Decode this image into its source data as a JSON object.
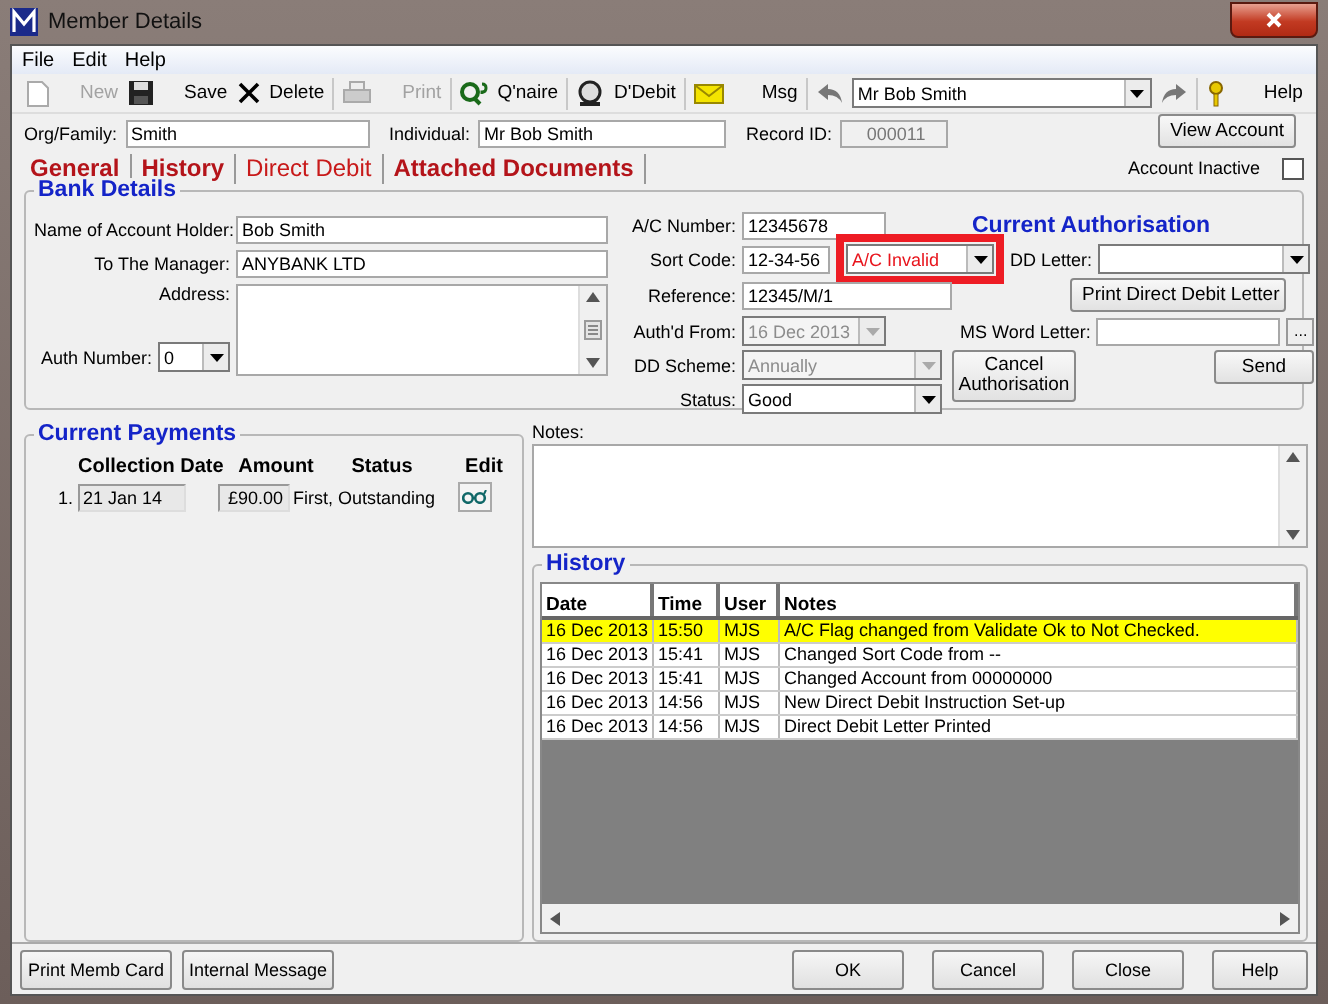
{
  "window": {
    "title": "Member Details"
  },
  "menu": [
    {
      "label": "File"
    },
    {
      "label": "Edit"
    },
    {
      "label": "Help"
    }
  ],
  "toolbar": [
    [
      {
        "kind": "button",
        "label": "New",
        "disabled": true
      },
      {
        "kind": "button",
        "label": "Save",
        "disabled": false
      },
      {
        "kind": "button",
        "label": "Delete",
        "disabled": false
      }
    ],
    [
      {
        "kind": "button",
        "label": "Print",
        "disabled": true
      }
    ],
    [
      {
        "kind": "button",
        "label": "Q'naire",
        "disabled": false
      }
    ],
    [
      {
        "kind": "button",
        "label": "D'Debit",
        "disabled": false
      }
    ],
    [
      {
        "kind": "button",
        "label": "Msg",
        "disabled": false
      }
    ],
    [
      {
        "kind": "icon_button"
      },
      {
        "kind": "combo",
        "value": "Mr Bob Smith"
      },
      {
        "kind": "icon_button"
      }
    ],
    [
      {
        "kind": "button",
        "label": "Help",
        "disabled": false
      }
    ]
  ],
  "header": {
    "org_family": {
      "label": "Org/Family:",
      "value": "Smith"
    },
    "individual": {
      "label": "Individual:",
      "value": "Mr Bob Smith"
    },
    "record_id": {
      "label": "Record ID:",
      "value": "000011"
    },
    "view_account": "View Account",
    "account_inactive": {
      "label": "Account Inactive",
      "checked": false
    }
  },
  "tabs": [
    {
      "label": "General",
      "selected": false
    },
    {
      "label": "History",
      "selected": false
    },
    {
      "label": "Direct Debit",
      "selected": true
    },
    {
      "label": "Attached Documents",
      "selected": false
    }
  ],
  "bank_details": {
    "title": "Bank Details",
    "account_holder": {
      "label": "Name of Account Holder:",
      "value": "Bob Smith"
    },
    "manager": {
      "label": "To The Manager:",
      "value": "ANYBANK LTD"
    },
    "address": {
      "label": "Address:"
    },
    "auth_number": {
      "label": "Auth Number:",
      "value": "0"
    },
    "ac_number": {
      "label": "A/C Number:",
      "value": "12345678"
    },
    "sort_code": {
      "label": "Sort Code:",
      "value": "12-34-56"
    },
    "ac_flag": {
      "value": "A/C Invalid",
      "highlighted": true
    },
    "reference": {
      "label": "Reference:",
      "value": "12345/M/1"
    },
    "authd_from": {
      "label": "Auth'd From:",
      "value": "16 Dec 2013",
      "disabled": true
    },
    "dd_scheme": {
      "label": "DD Scheme:",
      "value": "Annually",
      "disabled": true
    },
    "status": {
      "label": "Status:",
      "value": "Good",
      "disabled": false
    },
    "cancel_button": "Cancel Authorisation"
  },
  "current_authorisation": {
    "title": "Current Authorisation",
    "dd_letter": {
      "label": "DD Letter:"
    },
    "print_button": "Print Direct Debit Letter",
    "ms_word_letter": {
      "label": "MS Word Letter:"
    },
    "browse_button": "...",
    "send_button": "Send"
  },
  "current_payments": {
    "title": "Current Payments",
    "columns": [
      "Collection Date",
      "Amount",
      "Status",
      "Edit"
    ],
    "rows": [
      {
        "index": "1.",
        "date": "21 Jan 14",
        "amount": "£90.00",
        "status": "First, Outstanding"
      }
    ]
  },
  "notes": {
    "label": "Notes:"
  },
  "history": {
    "title": "History",
    "columns": [
      "Date",
      "Time",
      "User",
      "Notes"
    ],
    "rows": [
      {
        "date": "16 Dec 2013",
        "time": "15:50",
        "user": "MJS",
        "notes": "A/C Flag changed from Validate Ok to Not Checked.",
        "selected": true
      },
      {
        "date": "16 Dec 2013",
        "time": "15:41",
        "user": "MJS",
        "notes": "Changed Sort Code from --",
        "selected": false
      },
      {
        "date": "16 Dec 2013",
        "time": "15:41",
        "user": "MJS",
        "notes": "Changed Account from 00000000",
        "selected": false
      },
      {
        "date": "16 Dec 2013",
        "time": "14:56",
        "user": "MJS",
        "notes": "New Direct Debit Instruction Set-up",
        "selected": false
      },
      {
        "date": "16 Dec 2013",
        "time": "14:56",
        "user": "MJS",
        "notes": "Direct Debit Letter Printed",
        "selected": false
      }
    ]
  },
  "footer": {
    "left": [
      "Print Memb Card",
      "Internal Message"
    ],
    "right": [
      "OK",
      "Cancel",
      "Close",
      "Help"
    ]
  }
}
